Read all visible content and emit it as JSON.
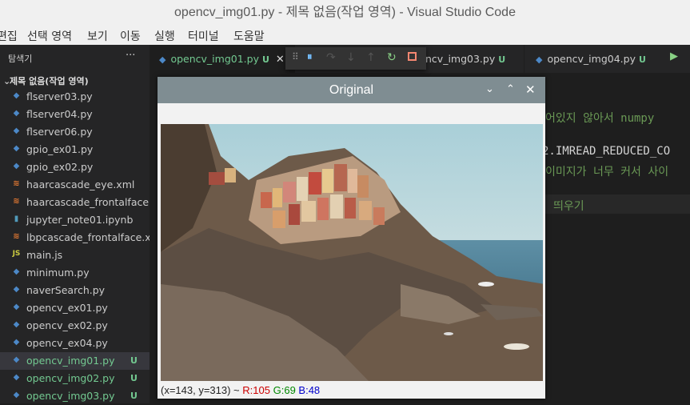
{
  "window": {
    "title": "opencv_img01.py - 제목 없음(작업 영역) - Visual Studio Code"
  },
  "menu": [
    "편집",
    "선택 영역",
    "보기",
    "이동",
    "실행",
    "터미널",
    "도움말"
  ],
  "sidebar": {
    "title": "탐색기",
    "more": "···",
    "folder": "제목 없음(작업 영역)",
    "items": [
      {
        "name": "flserver03.py",
        "icon": "python-icon"
      },
      {
        "name": "flserver04.py",
        "icon": "python-icon"
      },
      {
        "name": "flserver06.py",
        "icon": "python-icon"
      },
      {
        "name": "gpio_ex01.py",
        "icon": "python-icon"
      },
      {
        "name": "gpio_ex02.py",
        "icon": "python-icon"
      },
      {
        "name": "haarcascade_eye.xml",
        "icon": "rss-icon"
      },
      {
        "name": "haarcascade_frontalface...",
        "icon": "rss-icon"
      },
      {
        "name": "jupyter_note01.ipynb",
        "icon": "notebook-icon"
      },
      {
        "name": "lbpcascade_frontalface.x...",
        "icon": "rss-icon"
      },
      {
        "name": "main.js",
        "icon": "js-icon"
      },
      {
        "name": "minimum.py",
        "icon": "python-icon"
      },
      {
        "name": "naverSearch.py",
        "icon": "python-icon"
      },
      {
        "name": "opencv_ex01.py",
        "icon": "python-icon"
      },
      {
        "name": "opencv_ex02.py",
        "icon": "python-icon"
      },
      {
        "name": "opencv_ex04.py",
        "icon": "python-icon"
      },
      {
        "name": "opencv_img01.py",
        "icon": "python-icon",
        "badge": "U"
      },
      {
        "name": "opencv_img02.py",
        "icon": "python-icon",
        "badge": "U"
      },
      {
        "name": "opencv_img03.py",
        "icon": "python-icon",
        "badge": "U"
      }
    ]
  },
  "tabs": [
    {
      "label": "opencv_img01.py",
      "badge": "U",
      "close": "✕"
    },
    {
      "label": "ncv_img03.py",
      "badge": "U"
    },
    {
      "label": "opencv_img04.py",
      "badge": "U"
    }
  ],
  "code": {
    "line1": "어있지 않아서 numpy",
    "line2": "2.IMREAD_REDUCED_CO",
    "line3": "이미지가 너무 커서 사이",
    "line4": "띄우기"
  },
  "image_window": {
    "title": "Original",
    "status": {
      "coords": "(x=143, y=313) ~",
      "r": "R:105",
      "g": "G:69",
      "b": "B:48"
    }
  },
  "colors": {
    "accent_green": "#73c991",
    "python_blue": "#4c88c7",
    "r": "#cc0000",
    "g": "#008800",
    "b": "#0000cc"
  }
}
